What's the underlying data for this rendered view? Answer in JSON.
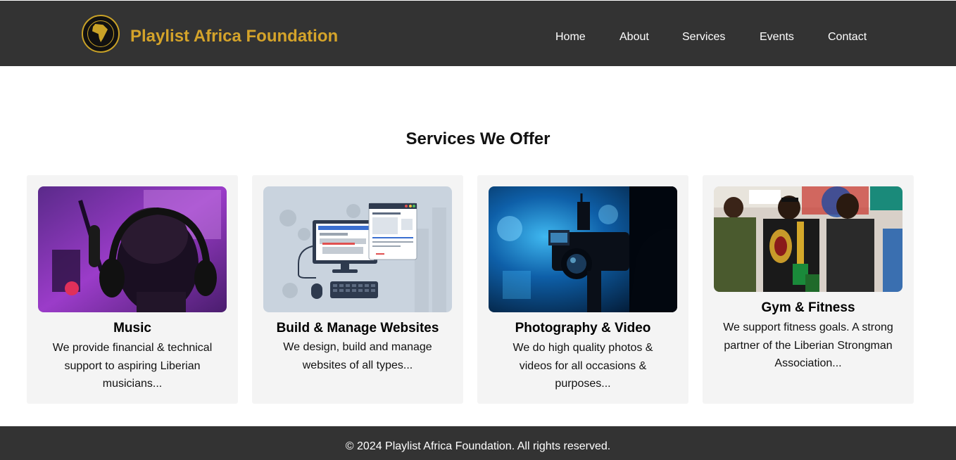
{
  "header": {
    "brand": "Playlist Africa Foundation",
    "nav": [
      "Home",
      "About",
      "Services",
      "Events",
      "Contact"
    ]
  },
  "main": {
    "title": "Services We Offer",
    "cards": [
      {
        "title": "Music",
        "text": "We provide financial & technical support to aspiring Liberian musicians..."
      },
      {
        "title": "Build & Manage Websites",
        "text": "We design, build and manage websites of all types..."
      },
      {
        "title": "Photography & Video",
        "text": "We do high quality photos & videos for all occasions & purposes..."
      },
      {
        "title": "Gym & Fitness",
        "text": "We support fitness goals. A strong partner of the Liberian Strongman Association..."
      }
    ]
  },
  "footer": {
    "copyright": "© 2024 Playlist Africa Foundation. All rights reserved."
  },
  "colors": {
    "header_bg": "#333333",
    "brand": "#d4a32a",
    "card_bg": "#f4f4f4"
  },
  "icons": [
    "logo-emblem"
  ]
}
